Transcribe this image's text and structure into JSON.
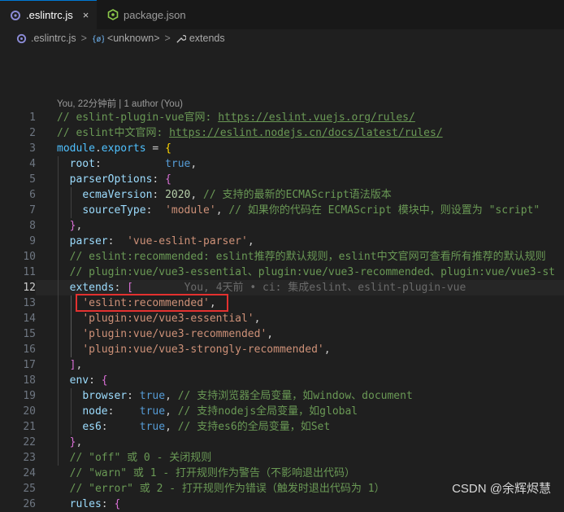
{
  "tabs": [
    {
      "label": ".eslintrc.js",
      "active": true,
      "close": "×"
    },
    {
      "label": "package.json",
      "active": false
    }
  ],
  "breadcrumb": {
    "file": ".eslintrc.js",
    "symbol": "<unknown>",
    "property": "extends",
    "sep": ">"
  },
  "blame_header": "You, 22分钟前 | 1 author (You)",
  "line_numbers": [
    "1",
    "2",
    "3",
    "4",
    "5",
    "6",
    "7",
    "8",
    "9",
    "10",
    "11",
    "12",
    "13",
    "14",
    "15",
    "16",
    "17",
    "18",
    "19",
    "20",
    "21",
    "22",
    "23",
    "24",
    "25",
    "26"
  ],
  "current_line": "12",
  "code": {
    "l1_comment": "// eslint-plugin-vue官网: ",
    "l1_url": "https://eslint.vuejs.org/rules/",
    "l2_comment": "// eslint中文官网: ",
    "l2_url": "https://eslint.nodejs.cn/docs/latest/rules/",
    "l3_module": "module",
    "l3_exports": "exports",
    "l4_key": "root",
    "l4_val": "true",
    "l5_key": "parserOptions",
    "l6_key": "ecmaVersion",
    "l6_val": "2020",
    "l6_comment": "// 支持的最新的ECMAScript语法版本",
    "l7_key": "sourceType",
    "l7_val": "'module'",
    "l7_comment": "// 如果你的代码在 ECMAScript 模块中，则设置为 \"script\"",
    "l9_key": "parser",
    "l9_val": "'vue-eslint-parser'",
    "l10_comment": "// eslint:recommended: eslint推荐的默认规则，eslint中文官网可查看所有推荐的默认规则",
    "l11_comment": "// plugin:vue/vue3-essential、plugin:vue/vue3-recommended、plugin:vue/vue3-st",
    "l12_key": "extends",
    "l12_ghost": "You, 4天前 • ci: 集成eslint、eslint-plugin-vue",
    "l13_str": "'eslint:recommended'",
    "l14_str": "'plugin:vue/vue3-essential'",
    "l15_str": "'plugin:vue/vue3-recommended'",
    "l16_str": "'plugin:vue/vue3-strongly-recommended'",
    "l18_key": "env",
    "l19_key": "browser",
    "l19_val": "true",
    "l19_comment": "// 支持浏览器全局变量，如window、document",
    "l20_key": "node",
    "l20_val": "true",
    "l20_comment": "// 支持nodejs全局变量，如global",
    "l21_key": "es6",
    "l21_val": "true",
    "l21_comment": "// 支持es6的全局变量，如Set",
    "l23_comment": "// \"off\" 或 0 - 关闭规则",
    "l24_comment": "// \"warn\" 或 1 - 打开规则作为警告（不影响退出代码）",
    "l25_comment": "// \"error\" 或 2 - 打开规则作为错误（触发时退出代码为 1）",
    "l26_key": "rules"
  },
  "watermark": "CSDN @余辉烬慧",
  "colors": {
    "accent": "#0078d4",
    "highlight_box": "#e3312f",
    "editor_bg": "#1f1f1f"
  }
}
